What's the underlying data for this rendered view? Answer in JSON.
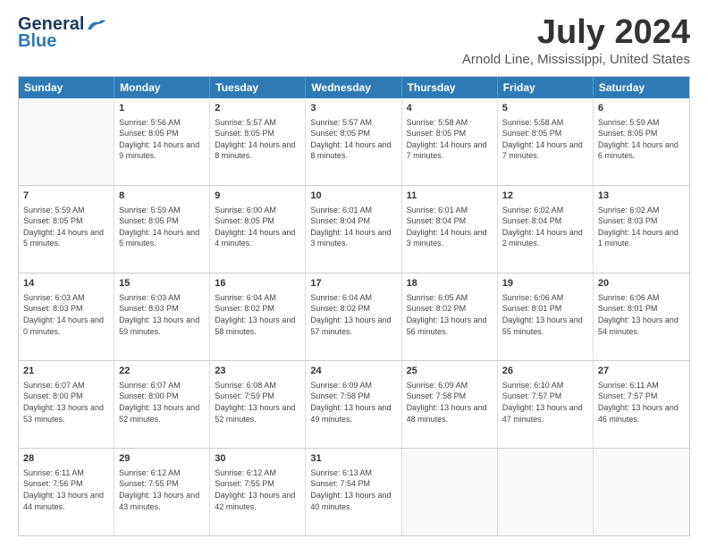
{
  "header": {
    "logo_line1": "General",
    "logo_line2": "Blue",
    "month_title": "July 2024",
    "location": "Arnold Line, Mississippi, United States"
  },
  "weekdays": [
    "Sunday",
    "Monday",
    "Tuesday",
    "Wednesday",
    "Thursday",
    "Friday",
    "Saturday"
  ],
  "weeks": [
    [
      {
        "day": "",
        "empty": true
      },
      {
        "day": "1",
        "sunrise": "5:56 AM",
        "sunset": "8:05 PM",
        "daylight": "14 hours and 9 minutes."
      },
      {
        "day": "2",
        "sunrise": "5:57 AM",
        "sunset": "8:05 PM",
        "daylight": "14 hours and 8 minutes."
      },
      {
        "day": "3",
        "sunrise": "5:57 AM",
        "sunset": "8:05 PM",
        "daylight": "14 hours and 8 minutes."
      },
      {
        "day": "4",
        "sunrise": "5:58 AM",
        "sunset": "8:05 PM",
        "daylight": "14 hours and 7 minutes."
      },
      {
        "day": "5",
        "sunrise": "5:58 AM",
        "sunset": "8:05 PM",
        "daylight": "14 hours and 7 minutes."
      },
      {
        "day": "6",
        "sunrise": "5:59 AM",
        "sunset": "8:05 PM",
        "daylight": "14 hours and 6 minutes."
      }
    ],
    [
      {
        "day": "7",
        "sunrise": "5:59 AM",
        "sunset": "8:05 PM",
        "daylight": "14 hours and 5 minutes."
      },
      {
        "day": "8",
        "sunrise": "5:59 AM",
        "sunset": "8:05 PM",
        "daylight": "14 hours and 5 minutes."
      },
      {
        "day": "9",
        "sunrise": "6:00 AM",
        "sunset": "8:05 PM",
        "daylight": "14 hours and 4 minutes."
      },
      {
        "day": "10",
        "sunrise": "6:01 AM",
        "sunset": "8:04 PM",
        "daylight": "14 hours and 3 minutes."
      },
      {
        "day": "11",
        "sunrise": "6:01 AM",
        "sunset": "8:04 PM",
        "daylight": "14 hours and 3 minutes."
      },
      {
        "day": "12",
        "sunrise": "6:02 AM",
        "sunset": "8:04 PM",
        "daylight": "14 hours and 2 minutes."
      },
      {
        "day": "13",
        "sunrise": "6:02 AM",
        "sunset": "8:03 PM",
        "daylight": "14 hours and 1 minute."
      }
    ],
    [
      {
        "day": "14",
        "sunrise": "6:03 AM",
        "sunset": "8:03 PM",
        "daylight": "14 hours and 0 minutes."
      },
      {
        "day": "15",
        "sunrise": "6:03 AM",
        "sunset": "8:03 PM",
        "daylight": "13 hours and 59 minutes."
      },
      {
        "day": "16",
        "sunrise": "6:04 AM",
        "sunset": "8:02 PM",
        "daylight": "13 hours and 58 minutes."
      },
      {
        "day": "17",
        "sunrise": "6:04 AM",
        "sunset": "8:02 PM",
        "daylight": "13 hours and 57 minutes."
      },
      {
        "day": "18",
        "sunrise": "6:05 AM",
        "sunset": "8:02 PM",
        "daylight": "13 hours and 56 minutes."
      },
      {
        "day": "19",
        "sunrise": "6:06 AM",
        "sunset": "8:01 PM",
        "daylight": "13 hours and 55 minutes."
      },
      {
        "day": "20",
        "sunrise": "6:06 AM",
        "sunset": "8:01 PM",
        "daylight": "13 hours and 54 minutes."
      }
    ],
    [
      {
        "day": "21",
        "sunrise": "6:07 AM",
        "sunset": "8:00 PM",
        "daylight": "13 hours and 53 minutes."
      },
      {
        "day": "22",
        "sunrise": "6:07 AM",
        "sunset": "8:00 PM",
        "daylight": "13 hours and 52 minutes."
      },
      {
        "day": "23",
        "sunrise": "6:08 AM",
        "sunset": "7:59 PM",
        "daylight": "13 hours and 52 minutes."
      },
      {
        "day": "24",
        "sunrise": "6:09 AM",
        "sunset": "7:58 PM",
        "daylight": "13 hours and 49 minutes."
      },
      {
        "day": "25",
        "sunrise": "6:09 AM",
        "sunset": "7:58 PM",
        "daylight": "13 hours and 48 minutes."
      },
      {
        "day": "26",
        "sunrise": "6:10 AM",
        "sunset": "7:57 PM",
        "daylight": "13 hours and 47 minutes."
      },
      {
        "day": "27",
        "sunrise": "6:11 AM",
        "sunset": "7:57 PM",
        "daylight": "13 hours and 46 minutes."
      }
    ],
    [
      {
        "day": "28",
        "sunrise": "6:11 AM",
        "sunset": "7:56 PM",
        "daylight": "13 hours and 44 minutes."
      },
      {
        "day": "29",
        "sunrise": "6:12 AM",
        "sunset": "7:55 PM",
        "daylight": "13 hours and 43 minutes."
      },
      {
        "day": "30",
        "sunrise": "6:12 AM",
        "sunset": "7:55 PM",
        "daylight": "13 hours and 42 minutes."
      },
      {
        "day": "31",
        "sunrise": "6:13 AM",
        "sunset": "7:54 PM",
        "daylight": "13 hours and 40 minutes."
      },
      {
        "day": "",
        "empty": true
      },
      {
        "day": "",
        "empty": true
      },
      {
        "day": "",
        "empty": true
      }
    ]
  ]
}
